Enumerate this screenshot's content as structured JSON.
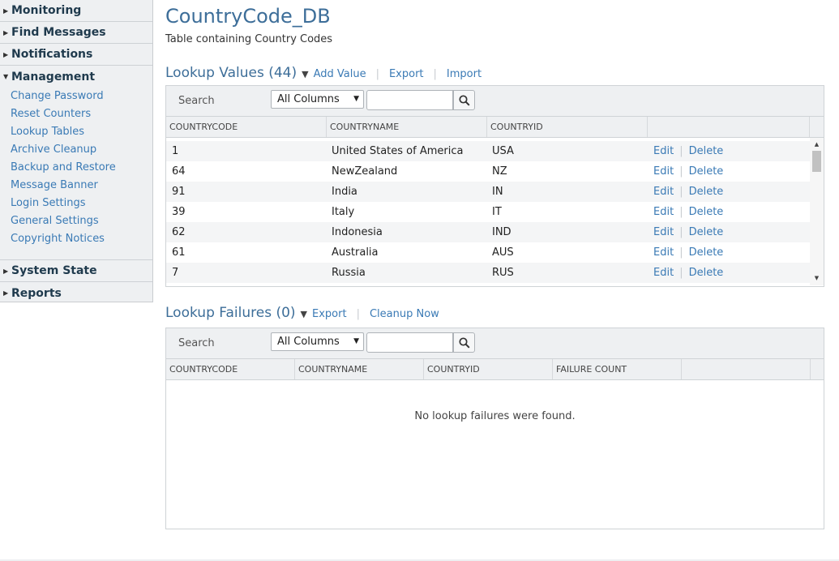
{
  "sidebar": {
    "sections_top": [
      {
        "label": "Monitoring"
      },
      {
        "label": "Find Messages"
      },
      {
        "label": "Notifications"
      }
    ],
    "management": {
      "label": "Management",
      "items": [
        "Change Password",
        "Reset Counters",
        "Lookup Tables",
        "Archive Cleanup",
        "Backup and Restore",
        "Message Banner",
        "Login Settings",
        "General Settings",
        "Copyright Notices"
      ]
    },
    "sections_bottom": [
      {
        "label": "System State"
      },
      {
        "label": "Reports"
      }
    ]
  },
  "page": {
    "title": "CountryCode_DB",
    "description": "Table containing Country Codes"
  },
  "lookup_values": {
    "title": "Lookup Values (44)",
    "links": {
      "add": "Add Value",
      "export": "Export",
      "import": "Import"
    },
    "search": {
      "label": "Search",
      "column_select": "All Columns",
      "input_value": ""
    },
    "columns": [
      "COUNTRYCODE",
      "COUNTRYNAME",
      "COUNTRYID",
      ""
    ],
    "row_actions": {
      "edit": "Edit",
      "delete": "Delete"
    },
    "rows": [
      {
        "code": "1",
        "name": "United States of America",
        "id": "USA"
      },
      {
        "code": "64",
        "name": "NewZealand",
        "id": "NZ"
      },
      {
        "code": "91",
        "name": "India",
        "id": "IN"
      },
      {
        "code": "39",
        "name": "Italy",
        "id": "IT"
      },
      {
        "code": "62",
        "name": "Indonesia",
        "id": "IND"
      },
      {
        "code": "61",
        "name": "Australia",
        "id": "AUS"
      },
      {
        "code": "7",
        "name": "Russia",
        "id": "RUS"
      }
    ]
  },
  "lookup_failures": {
    "title": "Lookup Failures (0)",
    "links": {
      "export": "Export",
      "cleanup": "Cleanup Now"
    },
    "search": {
      "label": "Search",
      "column_select": "All Columns",
      "input_value": ""
    },
    "columns": [
      "COUNTRYCODE",
      "COUNTRYNAME",
      "COUNTRYID",
      "FAILURE COUNT",
      ""
    ],
    "empty_message": "No lookup failures were found."
  },
  "colors": {
    "link": "#3a7ab5",
    "heading": "#3d6e99",
    "sidebar_bg": "#eef0f2"
  }
}
